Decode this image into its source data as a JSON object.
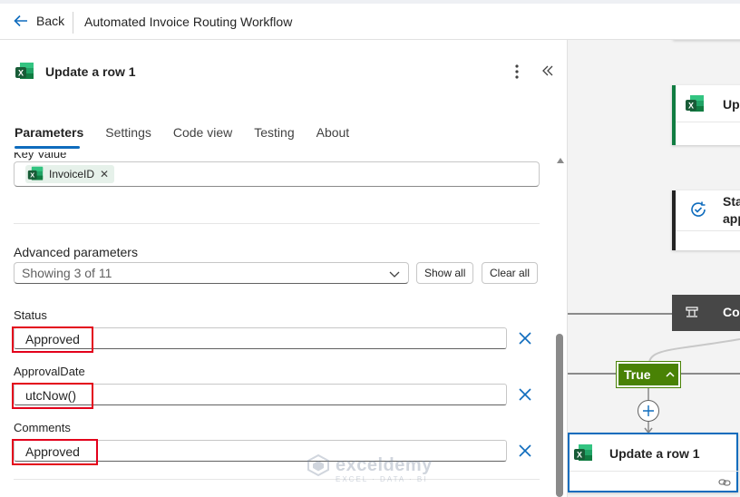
{
  "topbar": {
    "back_label": "Back",
    "flow_title": "Automated Invoice Routing Workflow"
  },
  "panel": {
    "title": "Update a row 1",
    "tabs": [
      {
        "label": "Parameters",
        "active": true
      },
      {
        "label": "Settings",
        "active": false
      },
      {
        "label": "Code view",
        "active": false
      },
      {
        "label": "Testing",
        "active": false
      },
      {
        "label": "About",
        "active": false
      }
    ],
    "key_value": {
      "label": "Key Value",
      "token": "InvoiceID"
    },
    "advanced": {
      "label": "Advanced parameters",
      "selected": "Showing 3 of 11",
      "show_all_label": "Show all",
      "clear_all_label": "Clear all"
    },
    "fields": [
      {
        "label": "Status",
        "value": "Approved"
      },
      {
        "label": "ApprovalDate",
        "value": "utcNow()"
      },
      {
        "label": "Comments",
        "value": "Approved"
      }
    ]
  },
  "canvas": {
    "card_update_partial": "Up",
    "card_status_line1": "Sta",
    "card_status_line2": "app",
    "card_condition_partial": "Co",
    "true_label": "True",
    "bottom_card_title": "Update a row 1"
  },
  "watermark": {
    "name": "exceldemy",
    "sub": "EXCEL · DATA · BI"
  },
  "colors": {
    "accent": "#0f6cbd",
    "excel_green": "#107c41",
    "true_green": "#498205",
    "highlight_red": "#e3001b",
    "condition_dark": "#474747"
  }
}
